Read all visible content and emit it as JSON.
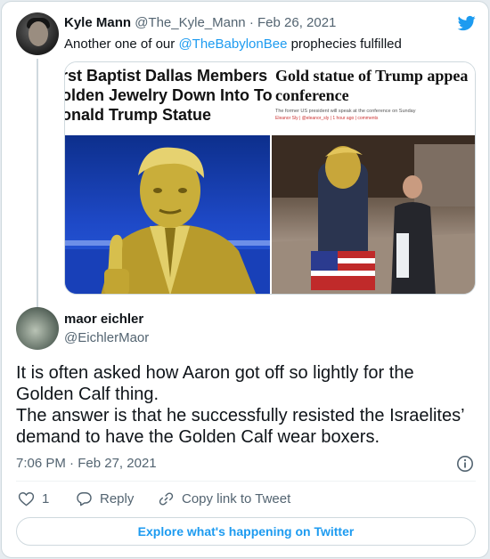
{
  "parent_tweet": {
    "name": "Kyle Mann",
    "handle": "@The_Kyle_Mann",
    "separator": "·",
    "date": "Feb 26, 2021",
    "text_prefix": "Another one of our ",
    "mention": "@TheBabylonBee",
    "text_suffix": " prophecies fulfilled",
    "media": {
      "left_headline": "rst Baptist Dallas Members M\nolden Jewelry Down Into Tow\nonald Trump Statue",
      "right_headline": "Gold statue of Trump appea\nconference",
      "right_subtitle": "The former US president will speak at the conference on Sunday",
      "right_byline": "Eleanor Sly | @eleanor_sly | 1 hour ago | comments"
    }
  },
  "main_tweet": {
    "name": "maor eichler",
    "handle": "@EichlerMaor",
    "body": "It is often asked how Aaron got off so lightly for the\nGolden Calf thing.\nThe answer is that he successfully resisted the Israelites’\ndemand to have the Golden Calf wear boxers.",
    "time": "7:06 PM",
    "separator": "·",
    "date": "Feb 27, 2021"
  },
  "actions": {
    "likes": "1",
    "reply_label": "Reply",
    "copy_label": "Copy link to Tweet"
  },
  "explore_label": "Explore what's happening on Twitter",
  "icons": {
    "brand": "twitter-bird-icon",
    "like": "heart-icon",
    "reply": "reply-bubble-icon",
    "copy": "link-icon",
    "info": "info-icon"
  },
  "colors": {
    "accent": "#1d9bf0",
    "secondary_text": "#536471",
    "border": "#cfd9de",
    "background": "#e6ecf0"
  }
}
